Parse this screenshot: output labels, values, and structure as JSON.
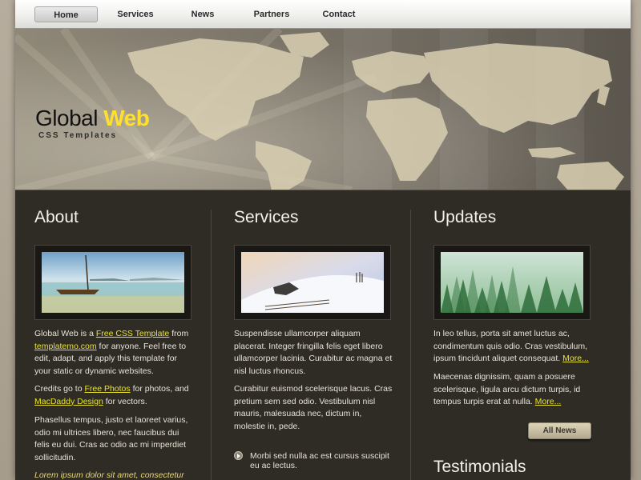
{
  "nav": {
    "items": [
      {
        "label": "Home",
        "active": true
      },
      {
        "label": "Services",
        "active": false
      },
      {
        "label": "News",
        "active": false
      },
      {
        "label": "Partners",
        "active": false
      },
      {
        "label": "Contact",
        "active": false
      }
    ]
  },
  "header": {
    "title_main": "Global",
    "title_accent": "Web",
    "subtitle": "CSS Templates",
    "accent_color": "#ffe02a"
  },
  "about": {
    "heading": "About",
    "p1_a": "Global Web is a ",
    "p1_link1": "Free CSS Template",
    "p1_b": " from",
    "p1_link2": "templatemo.com",
    "p1_c": " for anyone. Feel free to edit, adapt, and apply this template for your static or dynamic websites.",
    "p2_a": "Credits go to ",
    "p2_link1": "Free Photos",
    "p2_b": " for photos, and ",
    "p2_link2": "MacDaddy Design",
    "p2_c": " for vectors.",
    "p3": "Phasellus tempus, justo et laoreet varius, odio mi ultrices libero, nec faucibus dui felis eu dui. Cras ac odio ac mi imperdiet sollicitudin.",
    "p4": "Lorem ipsum dolor sit amet, consectetur"
  },
  "services": {
    "heading": "Services",
    "p1": "Suspendisse ullamcorper aliquam placerat. Integer fringilla felis eget libero ullamcorper lacinia. Curabitur ac magna et nisl luctus rhoncus.",
    "p2": "Curabitur euismod scelerisque lacus. Cras pretium sem sed odio. Vestibulum nisl mauris, malesuada nec, dictum in, molestie in, pede.",
    "bullet1": "Morbi sed nulla ac est cursus suscipit eu ac lectus."
  },
  "updates": {
    "heading": "Updates",
    "p1": "In leo tellus, porta sit amet luctus ac, condimentum quis odio. Cras vestibulum, ipsum tincidunt aliquet consequat. ",
    "p1_more": "More...",
    "p2": "Maecenas dignissim, quam a posuere scelerisque, ligula arcu dictum turpis, id tempus turpis erat at nulla. ",
    "p2_more": "More...",
    "button_label": "All News",
    "testimonials_heading": "Testimonials"
  },
  "colors": {
    "page_bg": "#2f2c26",
    "link": "#e8e22b",
    "text": "#e6e2d7"
  },
  "icons": {
    "bullet": "play-circle-icon"
  }
}
